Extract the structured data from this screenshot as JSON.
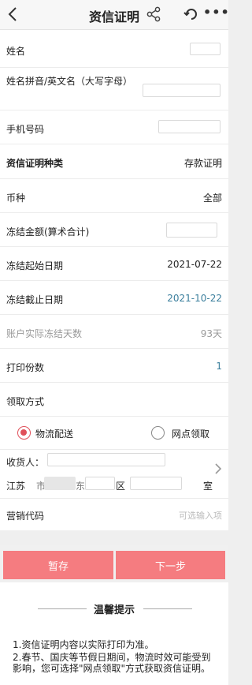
{
  "header": {
    "title": "资信证明",
    "back_icon": "chevron-left-icon",
    "share_icon": "share-icon",
    "refresh_icon": "refresh-icon",
    "more_icon": "more-icon",
    "more_label": "•••"
  },
  "form": {
    "name_label": "姓名",
    "pinyin_label": "姓名拼音/英文名（大写字母）",
    "phone_label": "手机号码",
    "type_label": "资信证明种类",
    "type_value": "存款证明",
    "currency_label": "币种",
    "currency_value": "全部",
    "amount_label": "冻结金额(算术合计)",
    "start_label": "冻结起始日期",
    "start_value": "2021-07-22",
    "end_label": "冻结截止日期",
    "end_value": "2021-10-22",
    "days_label": "账户实际冻结天数",
    "days_value": "93天",
    "copies_label": "打印份数",
    "copies_value": "1",
    "method_label": "领取方式",
    "option_logistics": "物流配送",
    "option_branch": "网点领取",
    "recipient_label": "收货人：",
    "address_parts": [
      "江苏",
      "市",
      "东",
      "区",
      "室"
    ],
    "marketing_label": "营销代码",
    "marketing_placeholder": "可选输入项"
  },
  "buttons": {
    "save": "暂存",
    "next": "下一步"
  },
  "tips": {
    "title": "温馨提示",
    "items": [
      "1.资信证明内容以实际打印为准。",
      "2.春节、国庆等节假日期间，物流时效可能受到影响，您可选择\"网点领取\"方式获取资信证明。"
    ]
  },
  "colors": {
    "accent": "#e0505a",
    "button": "#f57c80",
    "date_blue": "#3a7e9c"
  }
}
